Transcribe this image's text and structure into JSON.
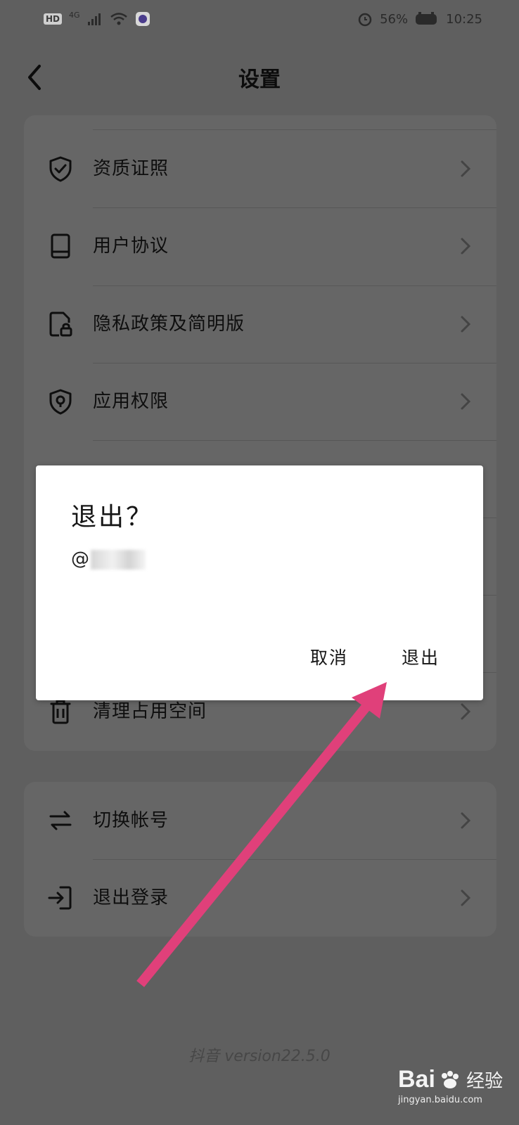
{
  "status_bar": {
    "hd": "HD",
    "network": "4G",
    "battery": "56%",
    "time": "10:25"
  },
  "header": {
    "title": "设置"
  },
  "settings_group_1": [
    {
      "label": "资质证照",
      "icon": "shield-check-icon"
    },
    {
      "label": "用户协议",
      "icon": "book-icon"
    },
    {
      "label": "隐私政策及简明版",
      "icon": "privacy-lock-icon"
    },
    {
      "label": "应用权限",
      "icon": "location-shield-icon"
    },
    {
      "label": "清理占用空间",
      "icon": "trash-icon"
    }
  ],
  "settings_group_2": [
    {
      "label": "切换帐号",
      "icon": "swap-arrows-icon"
    },
    {
      "label": "退出登录",
      "icon": "logout-icon"
    }
  ],
  "footer": {
    "app_name": "抖音",
    "version": "version22.5.0"
  },
  "dialog": {
    "title": "退出？",
    "account_prefix": "@",
    "cancel_label": "取消",
    "confirm_label": "退出"
  },
  "annotation": {
    "arrow_color": "#e0407a"
  },
  "watermark": {
    "brand": "Bai",
    "brand_cn": "经验",
    "url": "jingyan.baidu.com"
  }
}
